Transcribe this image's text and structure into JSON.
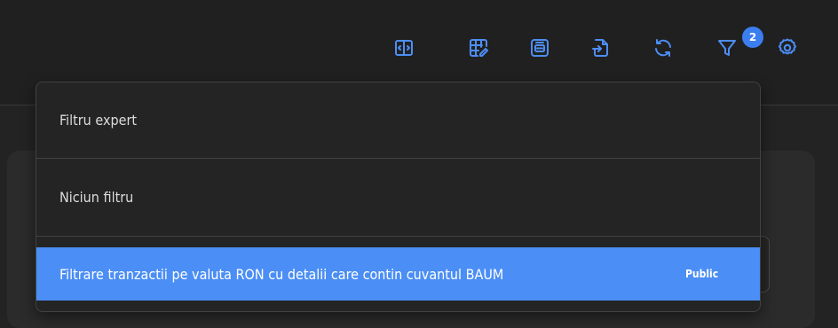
{
  "toolbar": {
    "icons": [
      {
        "name": "split-view-icon"
      },
      {
        "name": "table-edit-icon"
      },
      {
        "name": "print-icon"
      },
      {
        "name": "export-icon"
      },
      {
        "name": "refresh-icon"
      },
      {
        "name": "filter-icon"
      },
      {
        "name": "settings-icon"
      }
    ],
    "filter_count": "2",
    "accent_color": "#4d8ef5"
  },
  "filter_menu": {
    "items": [
      {
        "label": "Filtru expert"
      },
      {
        "label": "Niciun filtru"
      },
      {
        "label": "Filtrare tranzactii pe valuta RON cu detalii care contin cuvantul BAUM",
        "tag": "Public",
        "selected": true
      }
    ],
    "highlight_color": "#4b8ef5"
  }
}
